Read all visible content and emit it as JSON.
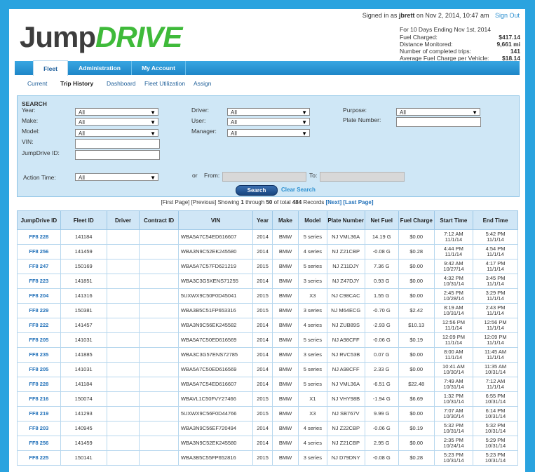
{
  "user": {
    "signed_in_prefix": "Signed in as",
    "username": "jbrett",
    "signed_in_suffix": "on Nov 2, 2014, 10:47 am",
    "sign_out": "Sign Out"
  },
  "logo": {
    "part1": "Jump",
    "part2": "DRIVE"
  },
  "summary": {
    "heading": "For 10 Days Ending Nov 1st, 2014",
    "rows": [
      {
        "label": "Fuel Charged:",
        "value": "$417.14"
      },
      {
        "label": "Distance Monitored:",
        "value": "9,661 mi"
      },
      {
        "label": "Number of completed trips:",
        "value": "141"
      },
      {
        "label": "Average Fuel Charge per Vehicle:",
        "value": "$18.14"
      }
    ]
  },
  "tabs": [
    "Fleet",
    "Administration",
    "My Account"
  ],
  "subnav": [
    "Current",
    "Trip History",
    "Dashboard",
    "Fleet Utilization",
    "Assign"
  ],
  "search": {
    "title": "SEARCH",
    "year_label": "Year:",
    "year_value": "All",
    "make_label": "Make:",
    "make_value": "All",
    "model_label": "Model:",
    "model_value": "All",
    "vin_label": "VIN:",
    "jid_label": "JumpDrive ID:",
    "driver_label": "Driver:",
    "driver_value": "All",
    "user_label": "User:",
    "user_value": "All",
    "manager_label": "Manager:",
    "manager_value": "All",
    "purpose_label": "Purpose:",
    "purpose_value": "All",
    "plate_label": "Plate Number:",
    "action_label": "Action Time:",
    "action_value": "All",
    "or_label": "or",
    "from_label": "From:",
    "to_label": "To:",
    "search_button": "Search",
    "clear_link": "Clear Search"
  },
  "pager": {
    "first": "[First Page]",
    "prev": "[Previous]",
    "showing": "Showing",
    "start": "1",
    "through": "through",
    "end": "50",
    "of_total": "of total",
    "total": "484",
    "records": "Records",
    "next": "[Next]",
    "last": "[Last Page]"
  },
  "columns": [
    "JumpDrive ID",
    "Fleet ID",
    "Driver",
    "Contract ID",
    "VIN",
    "Year",
    "Make",
    "Model",
    "Plate Number",
    "Net Fuel",
    "Fuel Charge",
    "Start Time",
    "End Time"
  ],
  "rows": [
    {
      "jid": "FF8 228",
      "fleet": "141184",
      "driver": "",
      "contract": "",
      "vin": "WBA5A7C54ED616607",
      "year": "2014",
      "make": "BMW",
      "model": "5 series",
      "plate": "NJ VML36A",
      "net": "14.19 G",
      "charge": "$0.00",
      "start_t": "7:12 AM",
      "start_d": "11/1/14",
      "end_t": "5:42 PM",
      "end_d": "11/1/14"
    },
    {
      "jid": "FF8 256",
      "fleet": "141459",
      "driver": "",
      "contract": "",
      "vin": "WBA3N9C52EK245580",
      "year": "2014",
      "make": "BMW",
      "model": "4 series",
      "plate": "NJ Z21CBP",
      "net": "-0.08 G",
      "charge": "$0.28",
      "start_t": "4:44 PM",
      "start_d": "11/1/14",
      "end_t": "4:54 PM",
      "end_d": "11/1/14"
    },
    {
      "jid": "FF8 247",
      "fleet": "150169",
      "driver": "",
      "contract": "",
      "vin": "WBA5A7C57FD621219",
      "year": "2015",
      "make": "BMW",
      "model": "5 series",
      "plate": "NJ Z11DJY",
      "net": "7.36 G",
      "charge": "$0.00",
      "start_t": "9:42 AM",
      "start_d": "10/27/14",
      "end_t": "4:17 PM",
      "end_d": "11/1/14"
    },
    {
      "jid": "FF8 223",
      "icon": "",
      "fleet": "141851",
      "driver": "",
      "contract": "",
      "vin": "WBA3C3G5XENS71255",
      "year": "2014",
      "make": "BMW",
      "model": "3 series",
      "plate": "NJ Z47DJY",
      "net": "0.93 G",
      "charge": "$0.00",
      "start_t": "4:32 PM",
      "start_d": "10/31/14",
      "end_t": "3:45 PM",
      "end_d": "11/1/14"
    },
    {
      "jid": "FF8 204",
      "fleet": "141316",
      "driver": "",
      "contract": "",
      "vin": "5UXWX9C50F0D45041",
      "year": "2015",
      "make": "BMW",
      "model": "X3",
      "plate": "NJ C98CAC",
      "net": "1.55 G",
      "charge": "$0.00",
      "start_t": "2:45 PM",
      "start_d": "10/28/14",
      "end_t": "3:29 PM",
      "end_d": "11/1/14"
    },
    {
      "jid": "FF8 229",
      "fleet": "150381",
      "driver": "",
      "contract": "",
      "vin": "WBA3B5C51FP653316",
      "year": "2015",
      "make": "BMW",
      "model": "3 series",
      "plate": "NJ M64ECG",
      "net": "-0.70 G",
      "charge": "$2.42",
      "start_t": "8:19 AM",
      "start_d": "10/31/14",
      "end_t": "2:43 PM",
      "end_d": "11/1/14"
    },
    {
      "jid": "FF8 222",
      "fleet": "141457",
      "driver": "",
      "contract": "",
      "vin": "WBA3N9C56EK245582",
      "year": "2014",
      "make": "BMW",
      "model": "4 series",
      "plate": "NJ ZUB89S",
      "net": "-2.93 G",
      "charge": "$10.13",
      "start_t": "12:56 PM",
      "start_d": "11/1/14",
      "end_t": "12:56 PM",
      "end_d": "11/1/14"
    },
    {
      "jid": "FF8 205",
      "fleet": "141031",
      "driver": "",
      "contract": "",
      "vin": "WBA5A7C50ED616569",
      "year": "2014",
      "make": "BMW",
      "model": "5 series",
      "plate": "NJ A98CFF",
      "net": "-0.06 G",
      "charge": "$0.19",
      "start_t": "12:09 PM",
      "start_d": "11/1/14",
      "end_t": "12:09 PM",
      "end_d": "11/1/14"
    },
    {
      "jid": "FF8 235",
      "fleet": "141885",
      "driver": "",
      "contract": "",
      "vin": "WBA3C3G57ENS72785",
      "year": "2014",
      "make": "BMW",
      "model": "3 series",
      "plate": "NJ RVC53B",
      "net": "0.07 G",
      "charge": "$0.00",
      "start_t": "8:00 AM",
      "start_d": "11/1/14",
      "end_t": "11:45 AM",
      "end_d": "11/1/14"
    },
    {
      "jid": "FF8 205",
      "fleet": "141031",
      "driver": "",
      "contract": "",
      "vin": "WBA5A7C50ED616569",
      "year": "2014",
      "make": "BMW",
      "model": "5 series",
      "plate": "NJ A98CFF",
      "net": "2.33 G",
      "charge": "$0.00",
      "start_t": "10:41 AM",
      "start_d": "10/30/14",
      "end_t": "11:35 AM",
      "end_d": "10/31/14"
    },
    {
      "jid": "FF8 228",
      "fleet": "141184",
      "driver": "",
      "contract": "",
      "vin": "WBA5A7C54ED616607",
      "year": "2014",
      "make": "BMW",
      "model": "5 series",
      "plate": "NJ VML36A",
      "net": "-6.51 G",
      "charge": "$22.48",
      "start_t": "7:49 AM",
      "start_d": "10/31/14",
      "end_t": "7:12 AM",
      "end_d": "11/1/14"
    },
    {
      "jid": "FF8 216",
      "fleet": "150074",
      "driver": "",
      "contract": "",
      "vin": "WBAVL1C50FVY27466",
      "year": "2015",
      "make": "BMW",
      "model": "X1",
      "plate": "NJ VHY98B",
      "net": "-1.94 G",
      "charge": "$6.69",
      "start_t": "1:32 PM",
      "start_d": "10/31/14",
      "end_t": "6:55 PM",
      "end_d": "10/31/14"
    },
    {
      "jid": "FF8 219",
      "fleet": "141293",
      "driver": "",
      "contract": "",
      "vin": "5UXWX9C56F0D44766",
      "year": "2015",
      "make": "BMW",
      "model": "X3",
      "plate": "NJ SB767V",
      "net": "9.99 G",
      "charge": "$0.00",
      "start_t": "7:07 AM",
      "start_d": "10/30/14",
      "end_t": "6:14 PM",
      "end_d": "10/31/14"
    },
    {
      "jid": "FF8 203",
      "fleet": "140945",
      "driver": "",
      "contract": "",
      "vin": "WBA3N9C56EF720494",
      "year": "2014",
      "make": "BMW",
      "model": "4 series",
      "plate": "NJ Z22CBP",
      "net": "-0.06 G",
      "charge": "$0.19",
      "start_t": "5:32 PM",
      "start_d": "10/31/14",
      "end_t": "5:32 PM",
      "end_d": "10/31/14"
    },
    {
      "jid": "FF8 256",
      "fleet": "141459",
      "driver": "",
      "contract": "",
      "vin": "WBA3N9C52EK245580",
      "year": "2014",
      "make": "BMW",
      "model": "4 series",
      "plate": "NJ Z21CBP",
      "net": "2.95 G",
      "charge": "$0.00",
      "start_t": "2:35 PM",
      "start_d": "10/24/14",
      "end_t": "5:29 PM",
      "end_d": "10/31/14"
    },
    {
      "jid": "FF8 225",
      "fleet": "150141",
      "driver": "",
      "contract": "",
      "vin": "WBA3B5C55FP652816",
      "year": "2015",
      "make": "BMW",
      "model": "3 series",
      "plate": "NJ D79DNY",
      "net": "-0.08 G",
      "charge": "$0.28",
      "start_t": "5:23 PM",
      "start_d": "10/31/14",
      "end_t": "5:23 PM",
      "end_d": "10/31/14"
    }
  ]
}
